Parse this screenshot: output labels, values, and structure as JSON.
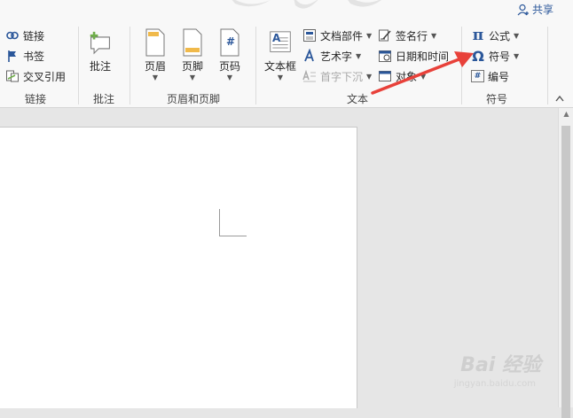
{
  "header": {
    "share_label": "共享"
  },
  "groups": {
    "links": {
      "label": "链接",
      "items": [
        {
          "label": "链接",
          "icon": "link-icon"
        },
        {
          "label": "书签",
          "icon": "bookmark-icon"
        },
        {
          "label": "交叉引用",
          "icon": "cross-reference-icon"
        }
      ]
    },
    "comments": {
      "label": "批注",
      "button": "批注"
    },
    "header_footer": {
      "label": "页眉和页脚",
      "header": "页眉",
      "footer": "页脚",
      "page_number": "页码",
      "page_number_glyph": "#"
    },
    "text": {
      "label": "文本",
      "textbox": "文本框",
      "textbox_glyph": "A",
      "quick_parts": "文档部件",
      "wordart": "艺术字",
      "dropcap": "首字下沉",
      "signature_line": "签名行",
      "date_time": "日期和时间",
      "object": "对象"
    },
    "symbols": {
      "label": "符号",
      "equation": "公式",
      "symbol": "符号",
      "numbering": "编号",
      "pi_glyph": "π",
      "omega_glyph": "Ω",
      "hash_glyph": "#"
    }
  },
  "watermark": {
    "brand": "Bai 经验",
    "url": "jingyan.baidu.com"
  },
  "colors": {
    "accent": "#2b579a",
    "arrow": "#e8413a",
    "green": "#6fae4a"
  }
}
